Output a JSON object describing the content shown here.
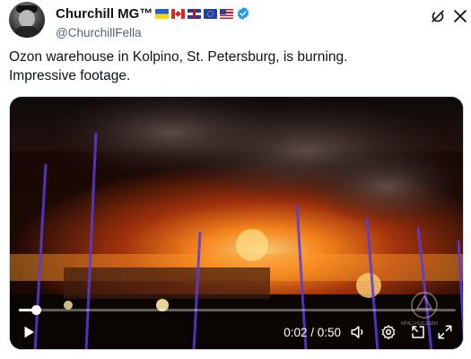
{
  "author": {
    "display_name": "Churchill MG™",
    "handle": "@ChurchillFella",
    "flags": [
      "ukraine-flag",
      "canada-flag",
      "uk-flag",
      "eu-flag",
      "usa-flag"
    ],
    "verified_color": "#1d9bf0"
  },
  "tweet": {
    "line1": "Ozon warehouse in Kolpino, St. Petersburg, is burning.",
    "line2": "Impressive footage."
  },
  "video": {
    "time_display": "0:02 / 0:50",
    "progress_fraction": 0.04,
    "watermark": "МЧС РОССИИ"
  },
  "colors": {
    "text_primary": "#0f1419",
    "text_secondary": "#536471",
    "accent": "#1d9bf0"
  }
}
